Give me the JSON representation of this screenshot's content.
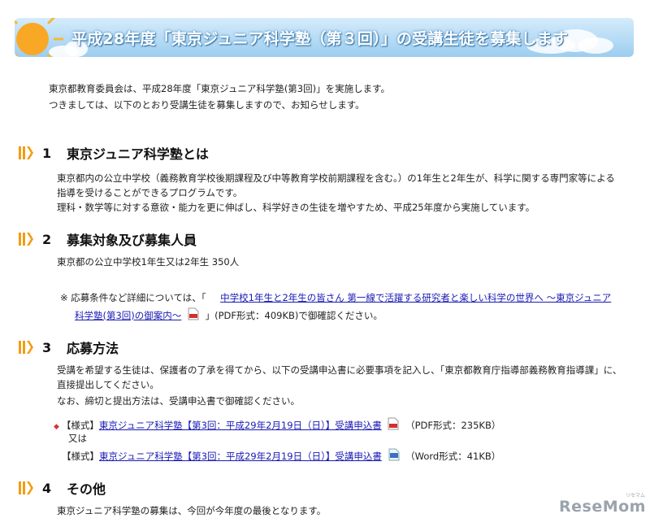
{
  "title": "平成28年度「東京ジュニア科学塾（第３回）」の受講生徒を募集します",
  "intro": [
    "東京都教育委員会は、平成28年度「東京ジュニア科学塾(第3回)」を実施します。",
    "つきましては、以下のとおり受講生徒を募集しますので、お知らせします。"
  ],
  "sections": [
    {
      "num": "1",
      "label": "東京ジュニア科学塾とは",
      "lines": [
        "東京都内の公立中学校（義務教育学校後期課程及び中等教育学校前期課程を含む。）の1年生と2年生が、科学に関する専門家等による",
        "指導を受けることができるプログラムです。",
        "理科・数学等に対する意欲・能力を更に伸ばし、科学好きの生徒を増やすため、平成25年度から実施しています。"
      ]
    },
    {
      "num": "2",
      "label": "募集対象及び募集人員",
      "lines": [
        "東京都の公立中学校1年生又は2年生 350人"
      ],
      "note": {
        "prefix": "※ 応募条件など詳細については、「",
        "link_line1": "中学校1年生と2年生の皆さん 第一線で活躍する研究者と楽しい科学の世界へ ～東京ジュニア",
        "link_line2": "科学塾(第3回)の御案内～",
        "suffix": "」(PDF形式：409KB)で御確認ください。"
      }
    },
    {
      "num": "3",
      "label": "応募方法",
      "lines": [
        "受講を希望する生徒は、保護者の了承を得てから、以下の受講申込書に必要事項を記入し、「東京都教育庁指導部義務教育指導課」に、",
        "直接提出してください。",
        "なお、締切と提出方法は、受講申込書で御確認ください。"
      ],
      "files": {
        "bullet": "◆",
        "item1_prefix": "【様式】",
        "item1_link": "東京ジュニア科学塾【第3回：平成29年2月19日（日）】受講申込書",
        "item1_suffix": "（PDF形式：235KB）",
        "or": "又は",
        "item2_prefix": "【様式】",
        "item2_link": "東京ジュニア科学塾【第3回：平成29年2月19日（日）】受講申込書",
        "item2_suffix": "（Word形式：41KB）"
      }
    },
    {
      "num": "4",
      "label": "その他",
      "lines": [
        "東京ジュニア科学塾の募集は、今回が今年度の最後となります。"
      ]
    }
  ],
  "watermark": {
    "text": "ReseMom",
    "small": "リセマム"
  },
  "colors": {
    "heading_mark": "#f39c12",
    "link": "#1a1ab5",
    "title_bg": "#9ccdf0"
  }
}
